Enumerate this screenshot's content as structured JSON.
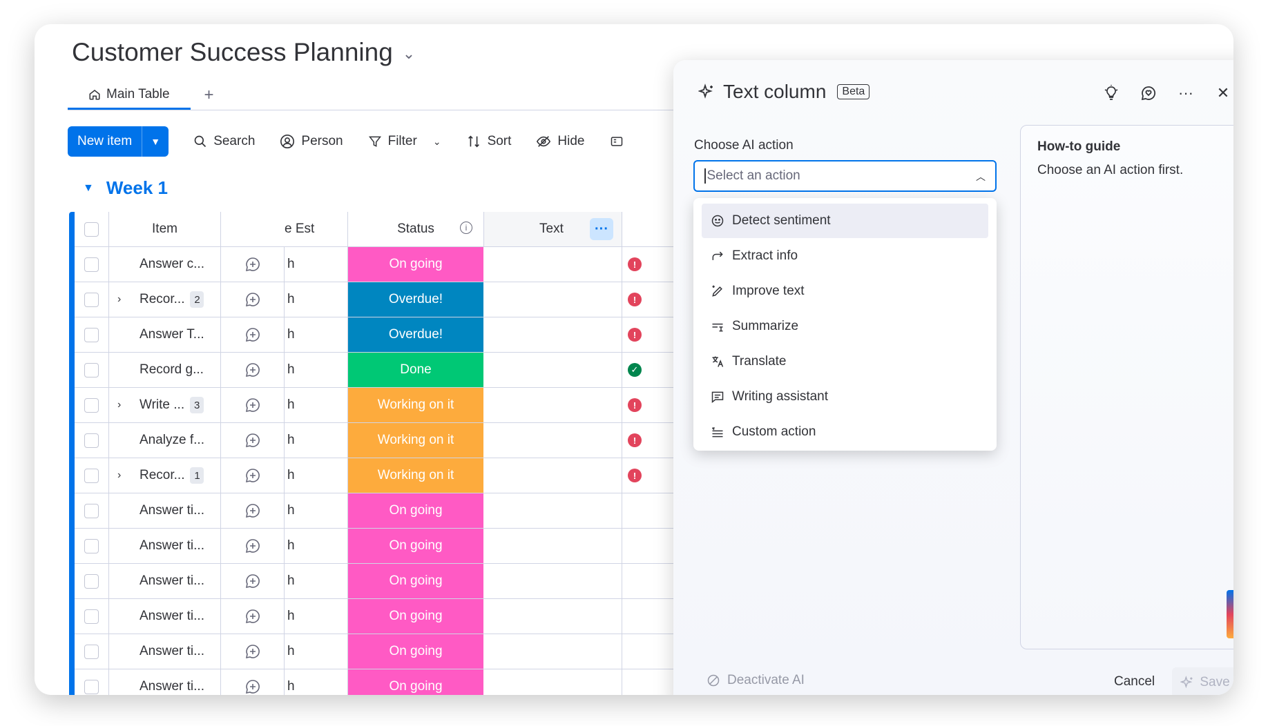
{
  "board": {
    "title": "Customer Success Planning",
    "tabs": [
      {
        "label": "Main Table"
      }
    ],
    "tab_add": "+"
  },
  "toolbar": {
    "new_item": "New item",
    "search": "Search",
    "person": "Person",
    "filter": "Filter",
    "sort": "Sort",
    "hide": "Hide"
  },
  "group": {
    "title": "Week 1"
  },
  "columns": {
    "item": "Item",
    "time_est": "Time Est",
    "time_est_visible": "e Est",
    "status": "Status",
    "text": "Text"
  },
  "rows": [
    {
      "item": "Answer c...",
      "subitems": "",
      "time": "h",
      "status": "On going",
      "status_color": "#ff5ac4",
      "flag": "!"
    },
    {
      "item": "Recor...",
      "subitems": "2",
      "time": "h",
      "status": "Overdue!",
      "status_color": "#0086c0",
      "flag": "!"
    },
    {
      "item": "Answer T...",
      "subitems": "",
      "time": "h",
      "status": "Overdue!",
      "status_color": "#0086c0",
      "flag": "!"
    },
    {
      "item": "Record g...",
      "subitems": "",
      "time": "h",
      "status": "Done",
      "status_color": "#00c875",
      "flag": "✓"
    },
    {
      "item": "Write ...",
      "subitems": "3",
      "time": "h",
      "status": "Working on it",
      "status_color": "#fdab3d",
      "flag": "!"
    },
    {
      "item": "Analyze f...",
      "subitems": "",
      "time": "h",
      "status": "Working on it",
      "status_color": "#fdab3d",
      "flag": "!"
    },
    {
      "item": "Recor...",
      "subitems": "1",
      "time": "h",
      "status": "Working on it",
      "status_color": "#fdab3d",
      "flag": "!"
    },
    {
      "item": "Answer ti...",
      "subitems": "",
      "time": "h",
      "status": "On going",
      "status_color": "#ff5ac4",
      "flag": ""
    },
    {
      "item": "Answer ti...",
      "subitems": "",
      "time": "h",
      "status": "On going",
      "status_color": "#ff5ac4",
      "flag": ""
    },
    {
      "item": "Answer ti...",
      "subitems": "",
      "time": "h",
      "status": "On going",
      "status_color": "#ff5ac4",
      "flag": ""
    },
    {
      "item": "Answer ti...",
      "subitems": "",
      "time": "h",
      "status": "On going",
      "status_color": "#ff5ac4",
      "flag": ""
    },
    {
      "item": "Answer ti...",
      "subitems": "",
      "time": "h",
      "status": "On going",
      "status_color": "#ff5ac4",
      "flag": ""
    },
    {
      "item": "Answer ti...",
      "subitems": "",
      "time": "h",
      "status": "On going",
      "status_color": "#ff5ac4",
      "flag": ""
    }
  ],
  "panel": {
    "title": "Text column",
    "badge": "Beta",
    "choose_label": "Choose AI action",
    "select_placeholder": "Select an action",
    "actions": [
      {
        "label": "Detect sentiment",
        "icon": "smiley-icon"
      },
      {
        "label": "Extract info",
        "icon": "arrow-forward-icon"
      },
      {
        "label": "Improve text",
        "icon": "pen-sparkle-icon"
      },
      {
        "label": "Summarize",
        "icon": "summarize-icon"
      },
      {
        "label": "Translate",
        "icon": "translate-icon"
      },
      {
        "label": "Writing assistant",
        "icon": "chat-lines-icon"
      },
      {
        "label": "Custom action",
        "icon": "list-indent-icon"
      }
    ],
    "guide_title": "How-to guide",
    "guide_text": "Choose an AI action first.",
    "deactivate": "Deactivate AI",
    "cancel": "Cancel",
    "save": "Save"
  },
  "colors": {
    "accent": "#0073ea",
    "on_going": "#ff5ac4",
    "overdue": "#0086c0",
    "done": "#00c875",
    "working": "#fdab3d",
    "alert": "#e2445c"
  }
}
